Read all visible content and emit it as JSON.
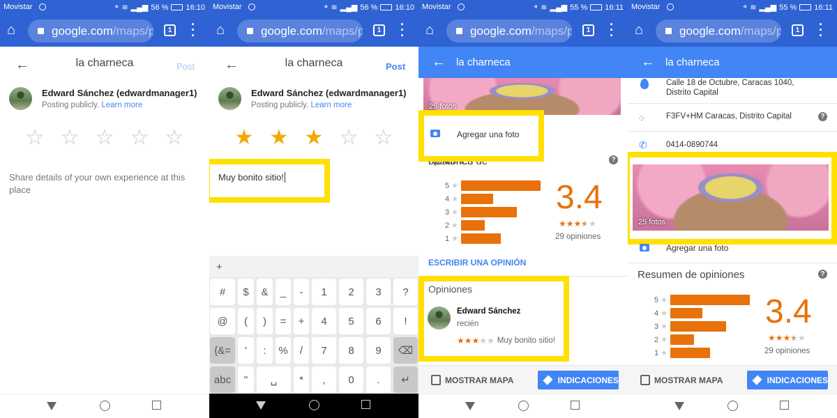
{
  "colors": {
    "browser_blue": "#2f62d3",
    "maps_blue": "#4285f4",
    "highlight": "#ffe000",
    "rating_orange": "#e8710a",
    "star_gold": "#f2a900"
  },
  "panels": [
    {
      "status": {
        "carrier": "Movistar",
        "battery": "56 %",
        "time": "16:10"
      },
      "browser": {
        "url_host": "google.com",
        "url_path": "/maps/p",
        "tab_count": "1"
      }
    },
    {
      "status": {
        "carrier": "Movistar",
        "battery": "56 %",
        "time": "16:10"
      },
      "browser": {
        "url_host": "google.com",
        "url_path": "/maps/p",
        "tab_count": "1"
      }
    },
    {
      "status": {
        "carrier": "Movistar",
        "battery": "55 %",
        "time": "16:11"
      },
      "browser": {
        "url_host": "google.com",
        "url_path": "/maps/p",
        "tab_count": "1"
      }
    },
    {
      "status": {
        "carrier": "Movistar",
        "battery": "55 %",
        "time": "16:11"
      },
      "browser": {
        "url_host": "google.com",
        "url_path": "/maps/p",
        "tab_count": "1"
      }
    }
  ],
  "review_form": {
    "title": "la charneca",
    "post_label": "Post",
    "user_name": "Edward Sánchez (edwardmanager1)",
    "posting": "Posting publicly.",
    "learn_more": "Learn more",
    "placeholder": "Share details of your own experience at this place",
    "typed_text": "Muy bonito sitio!",
    "empty_rating": 0,
    "selected_rating": 3
  },
  "keyboard": {
    "top": "+",
    "rows": [
      [
        "#",
        "$",
        "&",
        "_",
        "-",
        "1",
        "2",
        "3",
        "?"
      ],
      [
        "@",
        "(",
        ")",
        "=",
        "+",
        "4",
        "5",
        "6",
        "!"
      ],
      [
        "{&=",
        "'",
        ":",
        "%",
        "/",
        "7",
        "8",
        "9",
        "⌫"
      ],
      [
        "abc",
        "\"",
        "␣",
        "*",
        ",",
        "0",
        ".",
        "↵"
      ]
    ]
  },
  "place": {
    "title": "la charneca",
    "address": "Calle 18 de Octubre, Caracas 1040, Distrito Capital",
    "plus_code": "F3FV+HM Caracas, Distrito Capital",
    "phone": "0414-0890744",
    "photos": "25 fotos",
    "add_photo": "Agregar una foto",
    "summary_title": "Resumen de opiniones",
    "help": "?",
    "rating": "3.4",
    "rating_value": 3.4,
    "reviews_count": "29 opiniones",
    "histogram": [
      {
        "stars": "5",
        "count": 10
      },
      {
        "stars": "4",
        "count": 4
      },
      {
        "stars": "3",
        "count": 7
      },
      {
        "stars": "2",
        "count": 3
      },
      {
        "stars": "1",
        "count": 5
      }
    ],
    "write_review": "ESCRIBIR UNA OPINIÓN",
    "reviews_title": "Opiniones",
    "review": {
      "author": "Edward Sánchez",
      "when": "recién",
      "rating": 3,
      "text": "Muy bonito sitio!"
    },
    "show_map": "MOSTRAR MAPA",
    "directions": "INDICACIONES"
  }
}
